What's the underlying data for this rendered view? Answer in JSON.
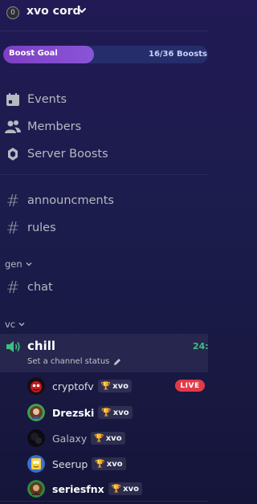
{
  "server": {
    "name": "xvo cord",
    "icon_letter": "0"
  },
  "boost": {
    "label": "Boost Goal",
    "count": "16/36 Boosts",
    "progress_fraction": 0.444
  },
  "menu": [
    {
      "label": "Events",
      "icon": "calendar-icon"
    },
    {
      "label": "Members",
      "icon": "members-icon"
    },
    {
      "label": "Server Boosts",
      "icon": "boost-gem-icon"
    }
  ],
  "text_channels_top": [
    {
      "label": "announcments"
    },
    {
      "label": "rules"
    }
  ],
  "categories": {
    "gen": {
      "label": "gen",
      "channels": [
        {
          "label": "chat"
        }
      ]
    },
    "vc": {
      "label": "vc"
    }
  },
  "voice_channel": {
    "name": "chill",
    "time": "24:",
    "status_placeholder": "Set a channel status"
  },
  "users": [
    {
      "name": "cryptofv",
      "tag": "xvo",
      "live": "LIVE",
      "color": "#dbdee1"
    },
    {
      "name": "Drezski",
      "tag": "xvo",
      "color": "#ffffff"
    },
    {
      "name": "Galaxy",
      "tag": "xvo",
      "color": "#b5bac1"
    },
    {
      "name": "Seerup",
      "tag": "xvo",
      "color": "#dbdee1"
    },
    {
      "name": "seriesfnx",
      "tag": "xvo",
      "color": "#ffffff"
    }
  ],
  "colors": {
    "live": "#e23a47",
    "boost_fill": "#7d3fc4",
    "time": "#3fbf7f"
  }
}
